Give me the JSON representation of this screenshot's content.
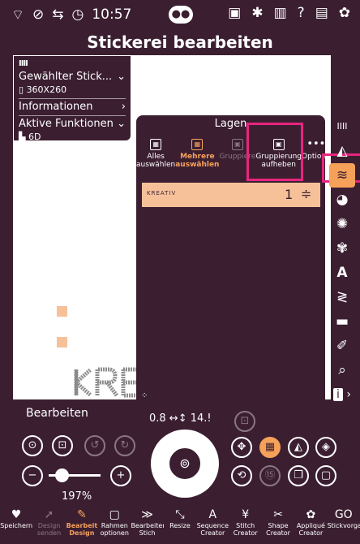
{
  "status": {
    "time": "10:57"
  },
  "title": "Stickerei bearbeiten",
  "info": {
    "selected": "Gewählter Stick...",
    "size": "360X260",
    "informationen": "Informationen",
    "active": "Aktive Funktionen",
    "hoop": "6D"
  },
  "layers": {
    "title": "Lagen",
    "tools": [
      {
        "line1": "Alles",
        "line2": "auswählen",
        "icon": "select-all-icon"
      },
      {
        "line1": "Mehrere",
        "line2": "auswählen",
        "icon": "select-multiple-icon"
      },
      {
        "line1": "Gruppiere",
        "line2": "",
        "icon": "group-icon"
      },
      {
        "line1": "Gruppierung",
        "line2": "aufheben",
        "icon": "ungroup-icon"
      },
      {
        "line1": "Optione",
        "line2": "",
        "icon": "more-icon"
      }
    ],
    "row": {
      "name": "KREATIV",
      "number": "1"
    }
  },
  "edit": {
    "title": "Bearbeiten",
    "zoom": "197%",
    "readout": "0.8 ↔↕ 14.!"
  },
  "bottom": [
    {
      "l1": "Speichern",
      "l2": "",
      "g": "♥"
    },
    {
      "l1": "Design",
      "l2": "senden",
      "g": "➚"
    },
    {
      "l1": "Bearbeit",
      "l2": "Design",
      "g": "✎"
    },
    {
      "l1": "Rahmen",
      "l2": "optionen",
      "g": "▢"
    },
    {
      "l1": "Bearbeiten",
      "l2": "Stich",
      "g": "≫"
    },
    {
      "l1": "Resize",
      "l2": "",
      "g": "⤡"
    },
    {
      "l1": "Sequence",
      "l2": "Creator",
      "g": "A"
    },
    {
      "l1": "Stitch",
      "l2": "Creator",
      "g": "¥"
    },
    {
      "l1": "Shape",
      "l2": "Creator",
      "g": "✂"
    },
    {
      "l1": "Appliqué",
      "l2": "Creator",
      "g": "✿"
    },
    {
      "l1": "Stickvorgang",
      "l2": "",
      "g": "GO"
    }
  ]
}
